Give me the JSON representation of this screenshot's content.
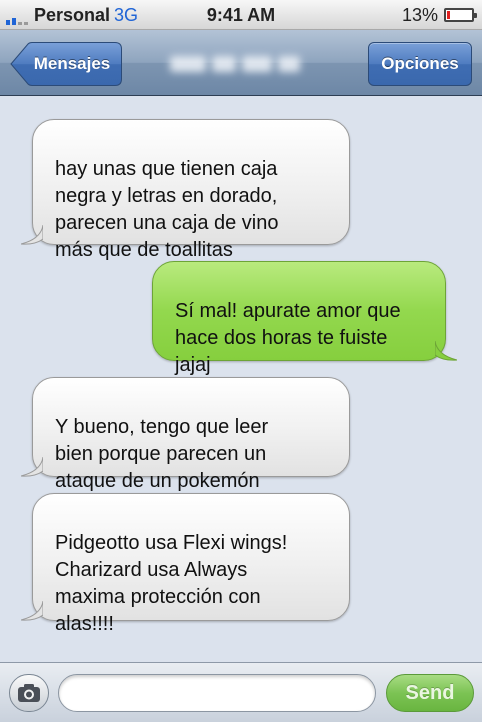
{
  "status_bar": {
    "carrier": "Personal",
    "network": "3G",
    "time": "9:41 AM",
    "battery_percent": "13%",
    "battery_level": 0.13,
    "signal_bars": 2,
    "icons": [
      "signal-bars-icon",
      "battery-icon"
    ]
  },
  "nav": {
    "back_label": "Mensajes",
    "options_label": "Opciones"
  },
  "messages": [
    {
      "direction": "received",
      "text": "hay unas que tienen caja\nnegra y letras en dorado,\nparecen una caja de vino\nmás que de toallitas"
    },
    {
      "direction": "sent",
      "text": "Sí mal! apurate amor que\nhace dos horas te fuiste\njajaj"
    },
    {
      "direction": "received",
      "text": "Y bueno, tengo que leer\nbien porque parecen un\nataque de un pokemón"
    },
    {
      "direction": "received",
      "text": "Pidgeotto usa Flexi wings!\nCharizard usa Always\nmaxima protección con\nalas!!!!"
    }
  ],
  "input_bar": {
    "placeholder": "",
    "value": "",
    "send_label": "Send",
    "camera_icon": "camera-icon"
  },
  "colors": {
    "sent_bubble": "#93d84e",
    "received_bubble": "#f0f0f0",
    "nav_bar": "#8ea4be",
    "options_button": "#4f7cc0",
    "background": "#dbe2ed"
  }
}
